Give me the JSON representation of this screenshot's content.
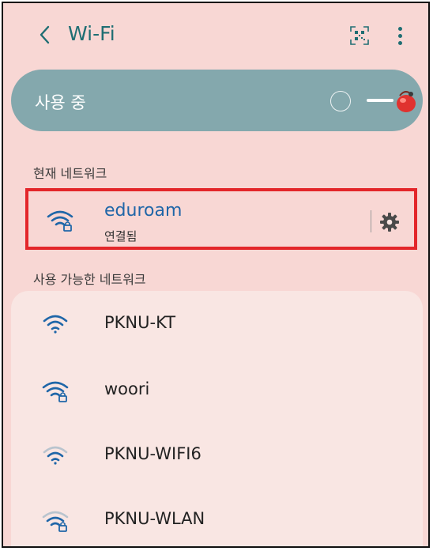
{
  "header": {
    "back_label": "<",
    "title": "Wi-Fi",
    "qr_icon": "qr-code-scan-icon",
    "more_icon": "more-vertical-icon"
  },
  "master": {
    "label": "사용 중",
    "toggle_state": "on"
  },
  "current_section": {
    "label": "현재 네트워크",
    "network": {
      "name": "eduroam",
      "status": "연결됨",
      "secured": true,
      "signal": "full"
    },
    "settings_icon": "gear-icon"
  },
  "available_section": {
    "label": "사용 가능한 네트워크",
    "networks": [
      {
        "name": "PKNU-KT",
        "secured": false,
        "signal": "full"
      },
      {
        "name": "woori",
        "secured": true,
        "signal": "full"
      },
      {
        "name": "PKNU-WIFI6",
        "secured": false,
        "signal": "weak"
      },
      {
        "name": "PKNU-WLAN",
        "secured": true,
        "signal": "weak"
      }
    ]
  },
  "colors": {
    "background": "#f8d7d4",
    "accent": "#1f6e73",
    "link_blue": "#1f66a8",
    "master_bar": "#84a8ad",
    "highlight_border": "#e3262a",
    "list_card": "#f9e6e3"
  }
}
